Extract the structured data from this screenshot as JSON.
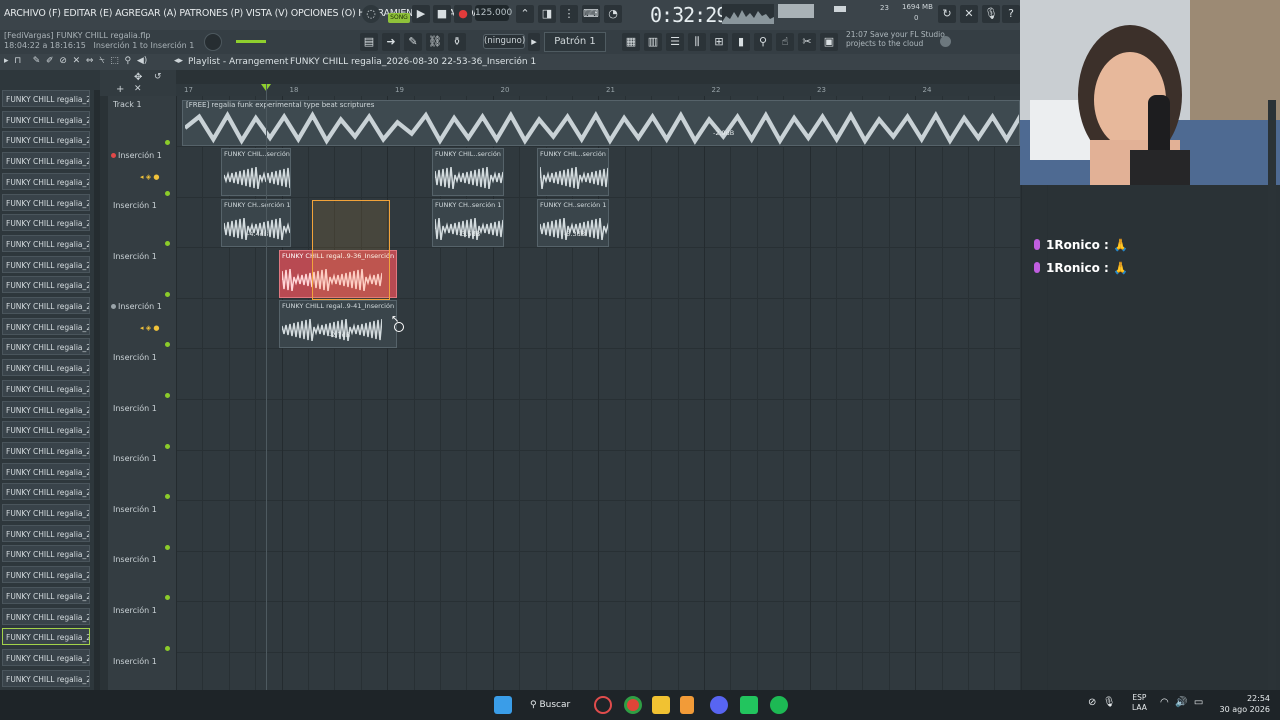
{
  "app": {
    "menu": "ARCHIVO (F) EDITAR (E) AGREGAR (A) PATRONES (P) VISTA (V) OPCIONES (O) HERRAMIENTAS (T) AYUDA",
    "project_user": "[FediVargas] FUNKY CHILL regalia.flp",
    "project_meta": "18:04:22 a 18:16:15",
    "project_insert": "Inserción 1 to Inserción 1",
    "song_label": "SONG",
    "bpm": "125.000",
    "time": "0:32:29",
    "cpu": "23",
    "ram": "1694 MB",
    "ram2": "0",
    "style_dropdown": "(ninguno)",
    "pattern": "Patrón 1",
    "cloud_msg_1": "21:07  Save your FL Studio",
    "cloud_msg_2": "projects to the cloud"
  },
  "playlist": {
    "title": "Playlist - Arrangement",
    "breadcrumb": "FUNKY CHILL regalia_2026-08-30 22-53-36_Inserción 1",
    "ruler": [
      "17",
      "18",
      "19",
      "20",
      "21",
      "22",
      "23",
      "24"
    ],
    "tracks": [
      {
        "name": "Track 1"
      },
      {
        "name": "Inserción 1"
      },
      {
        "name": "Inserción 1"
      },
      {
        "name": "Inserción 1"
      },
      {
        "name": "Inserción 1"
      },
      {
        "name": "Inserción 1"
      },
      {
        "name": "Inserción 1"
      },
      {
        "name": "Inserción 1"
      },
      {
        "name": "Inserción 1"
      },
      {
        "name": "Inserción 1"
      },
      {
        "name": "Inserción 1"
      },
      {
        "name": "Inserción 1"
      }
    ],
    "big_clip": {
      "label": "[FREE] regalia funk experimental type beat scriptures",
      "db": "-2.9dB"
    },
    "clips": [
      {
        "label": "FUNKY CHIL..serción 1",
        "db": ""
      },
      {
        "label": "FUNKY CHIL..serción 1",
        "db": ""
      },
      {
        "label": "FUNKY CHIL..serción 1",
        "db": ""
      },
      {
        "label": "FUNKY CH..serción 1",
        "db": "-4.4dB"
      },
      {
        "label": "FUNKY CH..serción 1",
        "db": "-3.5dB"
      },
      {
        "label": "FUNKY CH..serción 1",
        "db": "-3.3dB"
      },
      {
        "label": "FUNKY CHILL regal..9-36_Inserción 1",
        "db": ""
      },
      {
        "label": "FUNKY CHILL regal..9-41_Inserción 1",
        "db": "-2.7dB"
      }
    ]
  },
  "browser": {
    "items": [
      "FUNKY CHILL regalia_202...",
      "FUNKY CHILL regalia_202...",
      "FUNKY CHILL regalia_202...",
      "FUNKY CHILL regalia_202...",
      "FUNKY CHILL regalia_202...",
      "FUNKY CHILL regalia_202...",
      "FUNKY CHILL regalia_202...",
      "FUNKY CHILL regalia_202...",
      "FUNKY CHILL regalia_202...",
      "FUNKY CHILL regalia_202...",
      "FUNKY CHILL regalia_202...",
      "FUNKY CHILL regalia_202...",
      "FUNKY CHILL regalia_202...",
      "FUNKY CHILL regalia_202...",
      "FUNKY CHILL regalia_202...",
      "FUNKY CHILL regalia_202...",
      "FUNKY CHILL regalia_202...",
      "FUNKY CHILL regalia_202...",
      "FUNKY CHILL regalia_202...",
      "FUNKY CHILL regalia_202...",
      "FUNKY CHILL regalia_202...",
      "FUNKY CHILL regalia_202...",
      "FUNKY CHILL regalia_202...",
      "FUNKY CHILL regalia_202...",
      "FUNKY CHILL regalia_202...",
      "FUNKY CHILL regalia_202...",
      "FUNKY CHILL regalia_202...",
      "FUNKY CHILL regalia_202...",
      "FUNKY CHILL regalia_202..."
    ],
    "selected_index": 26
  },
  "chat": [
    {
      "user": "1Ronico :",
      "emoji": "🙏"
    },
    {
      "user": "1Ronico :",
      "emoji": "🙏"
    }
  ],
  "taskbar": {
    "search": "Buscar",
    "lang_1": "ESP",
    "lang_2": "LAA",
    "time": "22:54",
    "date": "30 ago 2026"
  }
}
